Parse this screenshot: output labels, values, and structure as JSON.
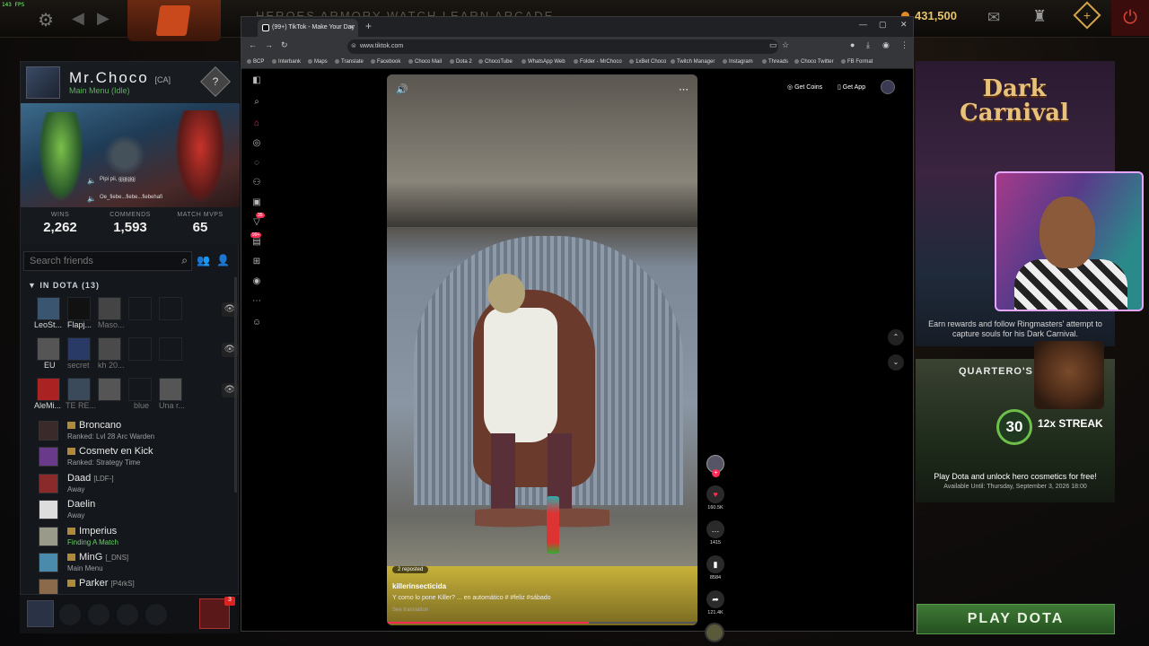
{
  "topbar": {
    "fps": "143 FPS",
    "gold": "431,500",
    "nav": "HEROES ARMORY WATCH LEARN ARCADE"
  },
  "profile": {
    "name": "Mr.Choco",
    "tag": "[CA]",
    "status": "Main Menu (Idle)",
    "rank_glyph": "?",
    "voice1": "Pipi pii, gjgjgjgj",
    "voice2": "Oe_fiebe...fiebe...fiebehafi",
    "stats": [
      {
        "label": "WINS",
        "value": "2,262"
      },
      {
        "label": "COMMENDS",
        "value": "1,593"
      },
      {
        "label": "MATCH MVPS",
        "value": "65"
      }
    ]
  },
  "friends": {
    "search_placeholder": "Search friends",
    "section_label": "IN DOTA",
    "section_count": "(13)",
    "party_rows": [
      {
        "names": [
          "LeoSt...",
          "Flapj...",
          "Maso..."
        ]
      },
      {
        "names": [
          "EU",
          "secret",
          "kh 20..."
        ]
      },
      {
        "names": [
          "AleMi...",
          "TE RE...",
          "",
          "blue",
          "Una r..."
        ]
      }
    ],
    "list": [
      {
        "name": "Broncano",
        "tag": "",
        "sub": "Ranked: Lvl 28 Arc Warden",
        "badge": true,
        "green": false
      },
      {
        "name": "Cosmetv en Kick",
        "tag": "",
        "sub": "Ranked: Strategy Time",
        "badge": true,
        "green": false
      },
      {
        "name": "Daad",
        "tag": "[LDF-]",
        "sub": "Away",
        "badge": false,
        "green": false
      },
      {
        "name": "Daelin",
        "tag": "",
        "sub": "Away",
        "badge": false,
        "green": false
      },
      {
        "name": "Imperius",
        "tag": "",
        "sub": "Finding A Match",
        "badge": true,
        "green": true
      },
      {
        "name": "MinG",
        "tag": "[_DNS]",
        "sub": "Main Menu",
        "badge": true,
        "green": false
      },
      {
        "name": "Parker",
        "tag": "[P4rkS]",
        "sub": "",
        "badge": true,
        "green": false
      }
    ],
    "chat_count": "3"
  },
  "browser": {
    "tab_title": "(99+) TikTok - Make Your Day",
    "url": "www.tiktok.com",
    "bookmarks": [
      "BCP",
      "Interbank",
      "Maps",
      "Translate",
      "Facebook",
      "Choco Mail",
      "Dota 2",
      "ChocoTube",
      "WhatsApp Web",
      "Folder - MrChoco",
      "1xBet Choco",
      "Twitch Manager",
      "Instagram",
      "Threads",
      "Choco Twitter",
      "FB Format"
    ]
  },
  "tiktok": {
    "get_coins": "Get Coins",
    "get_app": "Get App",
    "reposted": "2 reposted",
    "username": "killerinsecticida",
    "caption": "Y como lo pone Killer? ... en automático # #feliz #sábado",
    "see_translation": "See translation",
    "progress_fraction": 0.65,
    "likes": "160.5K",
    "comments": "1415",
    "saves": "8584",
    "shares": "121.4K",
    "inbox_badge": "99+",
    "notif_badge": "35"
  },
  "right": {
    "carnival_title": "Dark Carnival",
    "carnival_desc": "Earn rewards and follow Ringmasters' attempt to capture souls for his Dark Carnival.",
    "quarter_title": "QUARTERO'S C",
    "streak_num": "30",
    "streak_label": "12x STREAK",
    "quarter_desc": "Play Dota and unlock hero cosmetics for free!",
    "quarter_date": "Available Until: Thursday, September 3, 2026 18:00",
    "play_button": "PLAY DOTA"
  }
}
